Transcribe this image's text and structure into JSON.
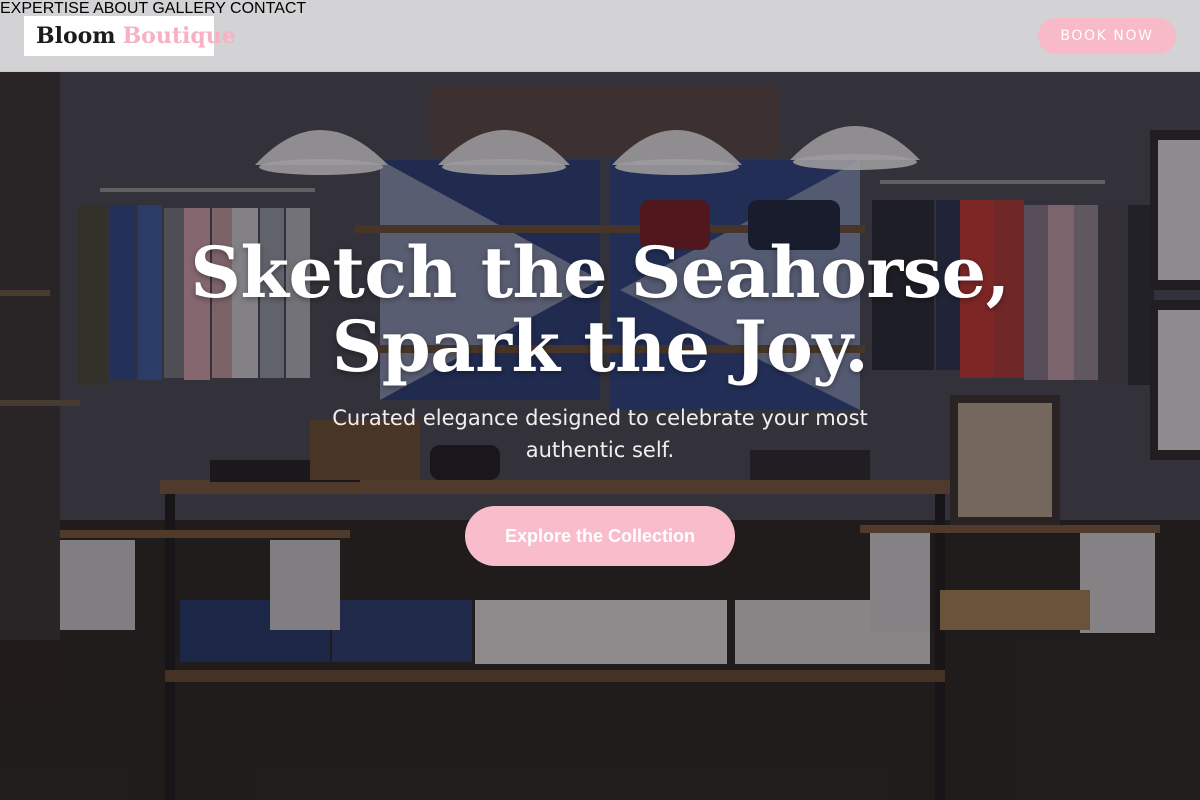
{
  "header": {
    "logo": {
      "word1": "Bloom",
      "word2": "Boutique"
    },
    "nav": [
      {
        "label": "EXPERTISE"
      },
      {
        "label": "ABOUT"
      },
      {
        "label": "GALLERY"
      },
      {
        "label": "CONTACT"
      }
    ],
    "book_button": "BOOK NOW"
  },
  "hero": {
    "title_line1": "Sketch the Seahorse,",
    "title_line2": "Spark the Joy.",
    "subtitle": "Curated elegance designed to celebrate your most authentic self.",
    "cta": "Explore the Collection"
  },
  "colors": {
    "accent_pink": "#f8b9c9",
    "header_bg": "#dedee0",
    "text_dark": "#2d2d2d"
  }
}
